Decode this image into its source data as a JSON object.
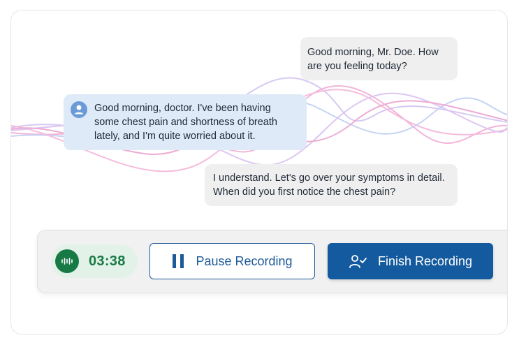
{
  "messages": [
    {
      "speaker": "doctor",
      "text": "Good morning, Mr. Doe. How are you feeling today?"
    },
    {
      "speaker": "patient",
      "text": "Good morning, doctor. I've been having some chest pain and shortness of breath lately, and I'm quite worried about it."
    },
    {
      "speaker": "doctor",
      "text": "I understand. Let's go over your symptoms in detail. When did you first notice the chest pain?"
    }
  ],
  "recording": {
    "timer": "03:38",
    "pause_label": "Pause Recording",
    "finish_label": "Finish Recording"
  },
  "colors": {
    "accent": "#145a9e",
    "timer_green": "#177a45",
    "timer_bg": "#e3f2e8",
    "patient_bubble": "#dfeaf8",
    "doctor_bubble": "#efefef"
  },
  "icons": {
    "patient_avatar": "user-avatar-icon",
    "timer": "audio-waveform-icon",
    "pause": "pause-icon",
    "finish": "user-check-icon"
  }
}
